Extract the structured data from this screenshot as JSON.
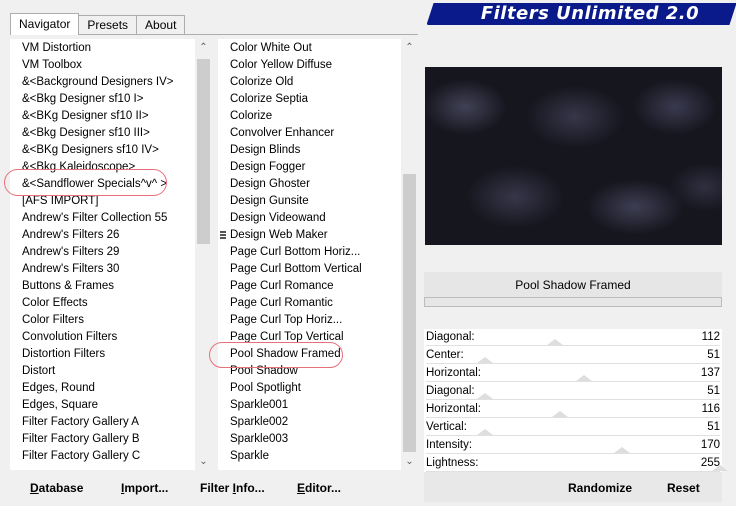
{
  "title": "Filters Unlimited 2.0",
  "tabs": [
    "Navigator",
    "Presets",
    "About"
  ],
  "categories": [
    "VM Distortion",
    "VM Toolbox",
    "&<Background Designers IV>",
    "&<Bkg Designer sf10 I>",
    "&<BKg Designer sf10 II>",
    "&<Bkg Designer sf10 III>",
    "&<BKg Designers sf10 IV>",
    "&<Bkg Kaleidoscope>",
    "&<Sandflower Specials^v^ >",
    "[AFS IMPORT]",
    "Andrew's Filter Collection 55",
    "Andrew's Filters 26",
    "Andrew's Filters 29",
    "Andrew's Filters 30",
    "Buttons & Frames",
    "Color Effects",
    "Color Filters",
    "Convolution Filters",
    "Distortion Filters",
    "Distort",
    "Edges, Round",
    "Edges, Square",
    "Filter Factory Gallery A",
    "Filter Factory Gallery B",
    "Filter Factory Gallery C"
  ],
  "filters": [
    "Color White Out",
    "Color Yellow Diffuse",
    "Colorize Old",
    "Colorize Septia",
    "Colorize",
    "Convolver Enhancer",
    "Design Blinds",
    "Design Fogger",
    "Design Ghoster",
    "Design Gunsite",
    "Design Videowand",
    "Design Web Maker",
    "Page Curl Bottom Horiz...",
    "Page Curl Bottom Vertical",
    "Page Curl Romance",
    "Page Curl Romantic",
    "Page Curl Top Horiz...",
    "Page Curl Top Vertical",
    "Pool Shadow Framed",
    "Pool Shadow",
    "Pool Spotlight",
    "Sparkle001",
    "Sparkle002",
    "Sparkle003",
    "Sparkle"
  ],
  "selected_filter": "Pool Shadow Framed",
  "params": [
    {
      "label": "Diagonal:",
      "value": "112",
      "level": 112
    },
    {
      "label": "Center:",
      "value": "51",
      "level": 51
    },
    {
      "label": "Horizontal:",
      "value": "137",
      "level": 137
    },
    {
      "label": "Diagonal:",
      "value": "51",
      "level": 51
    },
    {
      "label": "Horizontal:",
      "value": "116",
      "level": 116
    },
    {
      "label": "Vertical:",
      "value": "51",
      "level": 51
    },
    {
      "label": "Intensity:",
      "value": "170",
      "level": 170
    },
    {
      "label": "Lightness:",
      "value": "255",
      "level": 255
    }
  ],
  "buttons": {
    "database": {
      "u": "D",
      "rest": "atabase"
    },
    "import": {
      "u": "I",
      "rest": "mport..."
    },
    "filter_info": {
      "pre": "Filter ",
      "u": "I",
      "rest": "nfo..."
    },
    "editor": {
      "u": "E",
      "rest": "ditor..."
    },
    "randomize": "Randomize",
    "reset": "Reset"
  },
  "colors": {
    "banner": "#0a1a8a",
    "annotation": "#e8707a"
  }
}
